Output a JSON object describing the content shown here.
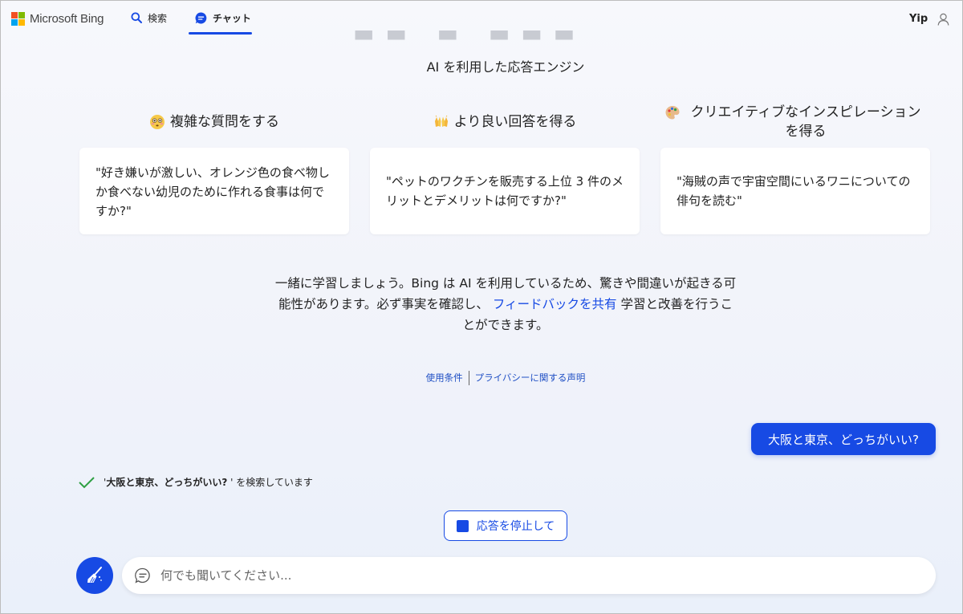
{
  "header": {
    "brand": "Microsoft Bing",
    "tabs": [
      {
        "label": "検索",
        "icon": "search-icon"
      },
      {
        "label": "チャット",
        "icon": "chat-icon",
        "active": true
      }
    ],
    "user_name": "Yip"
  },
  "intro": {
    "subtitle": "AI を利用した応答エンジン"
  },
  "features": [
    {
      "icon": "flushed-face-emoji",
      "title": "複雑な質問をする",
      "example": "\"好き嫌いが激しい、オレンジ色の食べ物しか食べない幼児のために作れる食事は何ですか?\""
    },
    {
      "icon": "raising-hands-emoji",
      "title": "より良い回答を得る",
      "example": "\"ペットのワクチンを販売する上位 3 件のメリットとデメリットは何ですか?\""
    },
    {
      "icon": "palette-emoji",
      "title": "クリエイティブなインスピレーションを得る",
      "example": "\"海賊の声で宇宙空間にいるワニについての俳句を読む\""
    }
  ],
  "disclaimer": {
    "text_before": "一緒に学習しましょう。Bing は AI を利用しているため、驚きや間違いが起きる可能性があります。必ず事実を確認し、",
    "link": "フィードバックを共有",
    "text_after": "学習と改善を行うことができます。"
  },
  "legal": {
    "terms": "使用条件",
    "privacy": "プライバシーに関する声明"
  },
  "chat": {
    "user_message": "大阪と東京、どっちがいい?",
    "status_prefix": "'",
    "status_query": "大阪と東京、どっちがいい?",
    "status_suffix": " ' を検索しています",
    "stop_label": "応答を停止して"
  },
  "composer": {
    "placeholder": "何でも聞いてください..."
  },
  "colors": {
    "accent": "#174ae4",
    "background": "#f3f5fb"
  }
}
